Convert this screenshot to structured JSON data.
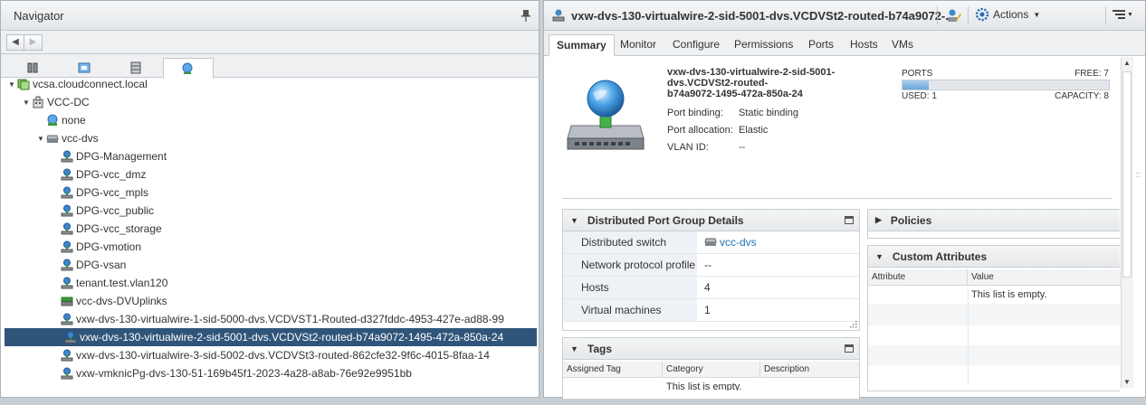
{
  "navigator": {
    "title": "Navigator",
    "tree": [
      {
        "label": "vcsa.cloudconnect.local",
        "icon": "vcenter-icon",
        "expanded": true
      },
      {
        "label": "VCC-DC",
        "icon": "datacenter-icon",
        "expanded": true
      },
      {
        "label": "none",
        "icon": "network-icon"
      },
      {
        "label": "vcc-dvs",
        "icon": "dvswitch-icon",
        "expanded": true
      },
      {
        "label": "DPG-Management",
        "icon": "portgroup-icon"
      },
      {
        "label": "DPG-vcc_dmz",
        "icon": "portgroup-icon"
      },
      {
        "label": "DPG-vcc_mpls",
        "icon": "portgroup-icon"
      },
      {
        "label": "DPG-vcc_public",
        "icon": "portgroup-icon"
      },
      {
        "label": "DPG-vcc_storage",
        "icon": "portgroup-icon"
      },
      {
        "label": "DPG-vmotion",
        "icon": "portgroup-icon"
      },
      {
        "label": "DPG-vsan",
        "icon": "portgroup-icon"
      },
      {
        "label": "tenant.test.vlan120",
        "icon": "portgroup-icon"
      },
      {
        "label": "vcc-dvs-DVUplinks",
        "icon": "uplinks-icon"
      },
      {
        "label": "vxw-dvs-130-virtualwire-1-sid-5000-dvs.VCDVST1-Routed-d327fddc-4953-427e-ad88-99",
        "icon": "portgroup-icon"
      },
      {
        "label": "vxw-dvs-130-virtualwire-2-sid-5001-dvs.VCDVSt2-routed-b74a9072-1495-472a-850a-24",
        "icon": "portgroup-icon",
        "selected": true
      },
      {
        "label": "vxw-dvs-130-virtualwire-3-sid-5002-dvs.VCDVSt3-routed-862cfe32-9f6c-4015-8faa-14",
        "icon": "portgroup-icon"
      },
      {
        "label": "vxw-vmknicPg-dvs-130-51-169b45f1-2023-4a28-a8ab-76e92e9951bb",
        "icon": "portgroup-icon"
      }
    ]
  },
  "main": {
    "title": "vxw-dvs-130-virtualwire-2-sid-5001-dvs.VCDVSt2-routed-b74a9072-...",
    "actions_label": "Actions",
    "tabs": [
      "Summary",
      "Monitor",
      "Configure",
      "Permissions",
      "Ports",
      "Hosts",
      "VMs"
    ],
    "active_tab": "Summary",
    "summary": {
      "name_lines": [
        "vxw-dvs-130-virtualwire-2-sid-5001-",
        "dvs.VCDVSt2-routed-",
        "b74a9072-1495-472a-850a-24"
      ],
      "port_binding_label": "Port binding:",
      "port_binding_value": "Static binding",
      "port_allocation_label": "Port allocation:",
      "port_allocation_value": "Elastic",
      "vlan_label": "VLAN ID:",
      "vlan_value": "--",
      "ports_label": "PORTS",
      "free_label": "FREE: 7",
      "used_label": "USED: 1",
      "capacity_label": "CAPACITY: 8",
      "used_fraction": 0.125
    },
    "details": {
      "title": "Distributed Port Group Details",
      "rows": [
        {
          "key": "Distributed switch",
          "value": "vcc-dvs",
          "link": true
        },
        {
          "key": "Network protocol profile",
          "value": "--"
        },
        {
          "key": "Hosts",
          "value": "4"
        },
        {
          "key": "Virtual machines",
          "value": "1"
        }
      ]
    },
    "tags": {
      "title": "Tags",
      "columns": [
        "Assigned Tag",
        "Category",
        "Description"
      ],
      "empty": "This list is empty."
    },
    "policies": {
      "title": "Policies"
    },
    "custom_attributes": {
      "title": "Custom Attributes",
      "columns": [
        "Attribute",
        "Value"
      ],
      "empty": "This list is empty."
    }
  },
  "colors": {
    "selection": "#30557a",
    "accent": "#1a73b5",
    "usage_bar": "#7fb3dc"
  }
}
